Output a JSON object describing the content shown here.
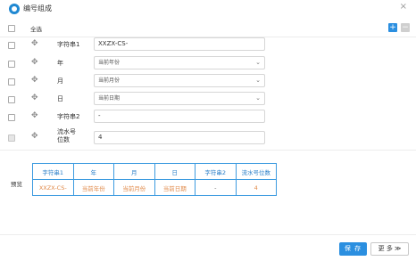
{
  "dialog": {
    "title": "编号组成",
    "close_glyph": "×"
  },
  "toolbar": {
    "select_all": "全选",
    "add_glyph": "+",
    "remove_glyph": "−"
  },
  "rows": [
    {
      "label": "字符串1",
      "value": "XXZX-CS-",
      "kind": "text"
    },
    {
      "label": "年",
      "value": "当前年份",
      "kind": "select"
    },
    {
      "label": "月",
      "value": "当前月份",
      "kind": "select"
    },
    {
      "label": "日",
      "value": "当前日期",
      "kind": "select"
    },
    {
      "label": "字符串2",
      "value": "-",
      "kind": "text"
    },
    {
      "label": "流水号\n位数",
      "value": "4",
      "kind": "text"
    }
  ],
  "preview": {
    "label": "预览",
    "headers": [
      "字符串1",
      "年",
      "月",
      "日",
      "字符串2",
      "流水号位数"
    ],
    "values": [
      "XXZX-CS-",
      "当前年份",
      "当前月份",
      "当前日期",
      "-",
      "4"
    ]
  },
  "footer": {
    "save_label": "保 存",
    "more_label": "更 多 ≫"
  },
  "colors": {
    "accent": "#2b8fe0",
    "preview_border": "#3d9be0",
    "preview_value": "#e08a4a"
  }
}
